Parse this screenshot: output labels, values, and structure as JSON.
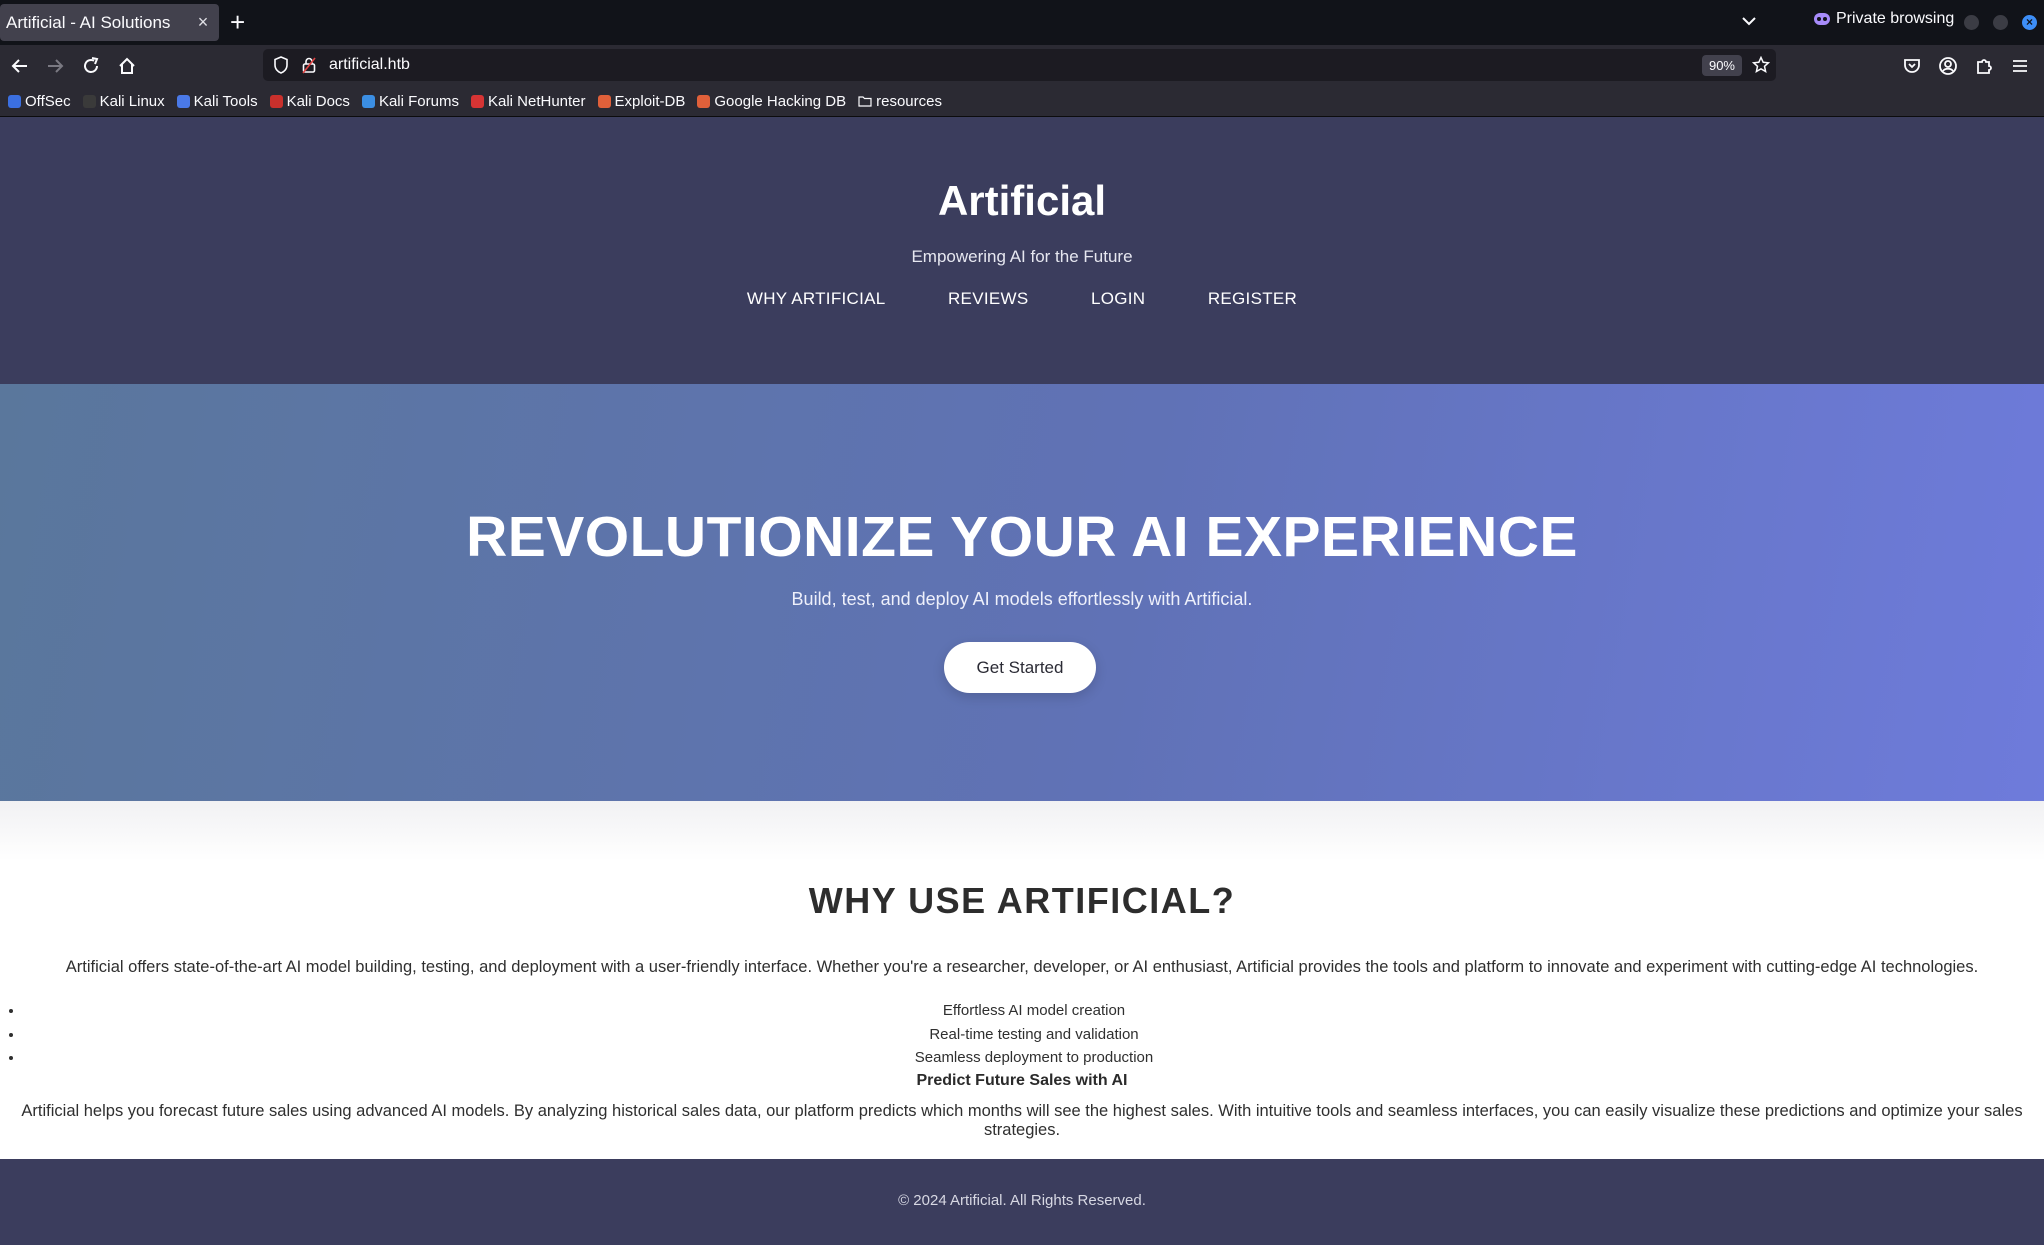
{
  "browser": {
    "tab_title": "Artificial - AI Solutions",
    "tab_close": "×",
    "new_tab": "+",
    "private_label": "Private browsing",
    "url": "artificial.htb",
    "zoom": "90%",
    "bookmarks": [
      {
        "label": "OffSec",
        "color": "#3b6fe0"
      },
      {
        "label": "Kali Linux",
        "color": "#3a3a3a"
      },
      {
        "label": "Kali Tools",
        "color": "#4a79e8"
      },
      {
        "label": "Kali Docs",
        "color": "#c9302c"
      },
      {
        "label": "Kali Forums",
        "color": "#3b8ee3"
      },
      {
        "label": "Kali NetHunter",
        "color": "#d63434"
      },
      {
        "label": "Exploit-DB",
        "color": "#e0603a"
      },
      {
        "label": "Google Hacking DB",
        "color": "#e0603a"
      },
      {
        "label": "resources",
        "color": "folder"
      }
    ]
  },
  "site": {
    "title": "Artificial",
    "tagline": "Empowering AI for the Future",
    "nav": [
      "WHY ARTIFICIAL",
      "REVIEWS",
      "LOGIN",
      "REGISTER"
    ]
  },
  "hero": {
    "heading": "REVOLUTIONIZE YOUR AI EXPERIENCE",
    "subheading": "Build, test, and deploy AI models effortlessly with Artificial.",
    "cta_label": "Get Started"
  },
  "features": {
    "heading": "WHY USE ARTIFICIAL?",
    "lead": "Artificial offers state-of-the-art AI model building, testing, and deployment with a user-friendly interface. Whether you're a researcher, developer, or AI enthusiast, Artificial provides the tools and platform to innovate and experiment with cutting-edge AI technologies.",
    "items": [
      "Effortless AI model creation",
      "Real-time testing and validation",
      "Seamless deployment to production"
    ],
    "predict_heading": "Predict Future Sales with AI",
    "predict_text": "Artificial helps you forecast future sales using advanced AI models. By analyzing historical sales data, our platform predicts which months will see the highest sales. With intuitive tools and seamless interfaces, you can easily visualize these predictions and optimize your sales strategies."
  },
  "footer": {
    "copyright": "© 2024 Artificial. All Rights Reserved."
  },
  "colors": {
    "header_bg": "#3b3d5d",
    "hero_gradient_start": "#5a779c",
    "hero_gradient_end": "#6e7bdb"
  }
}
